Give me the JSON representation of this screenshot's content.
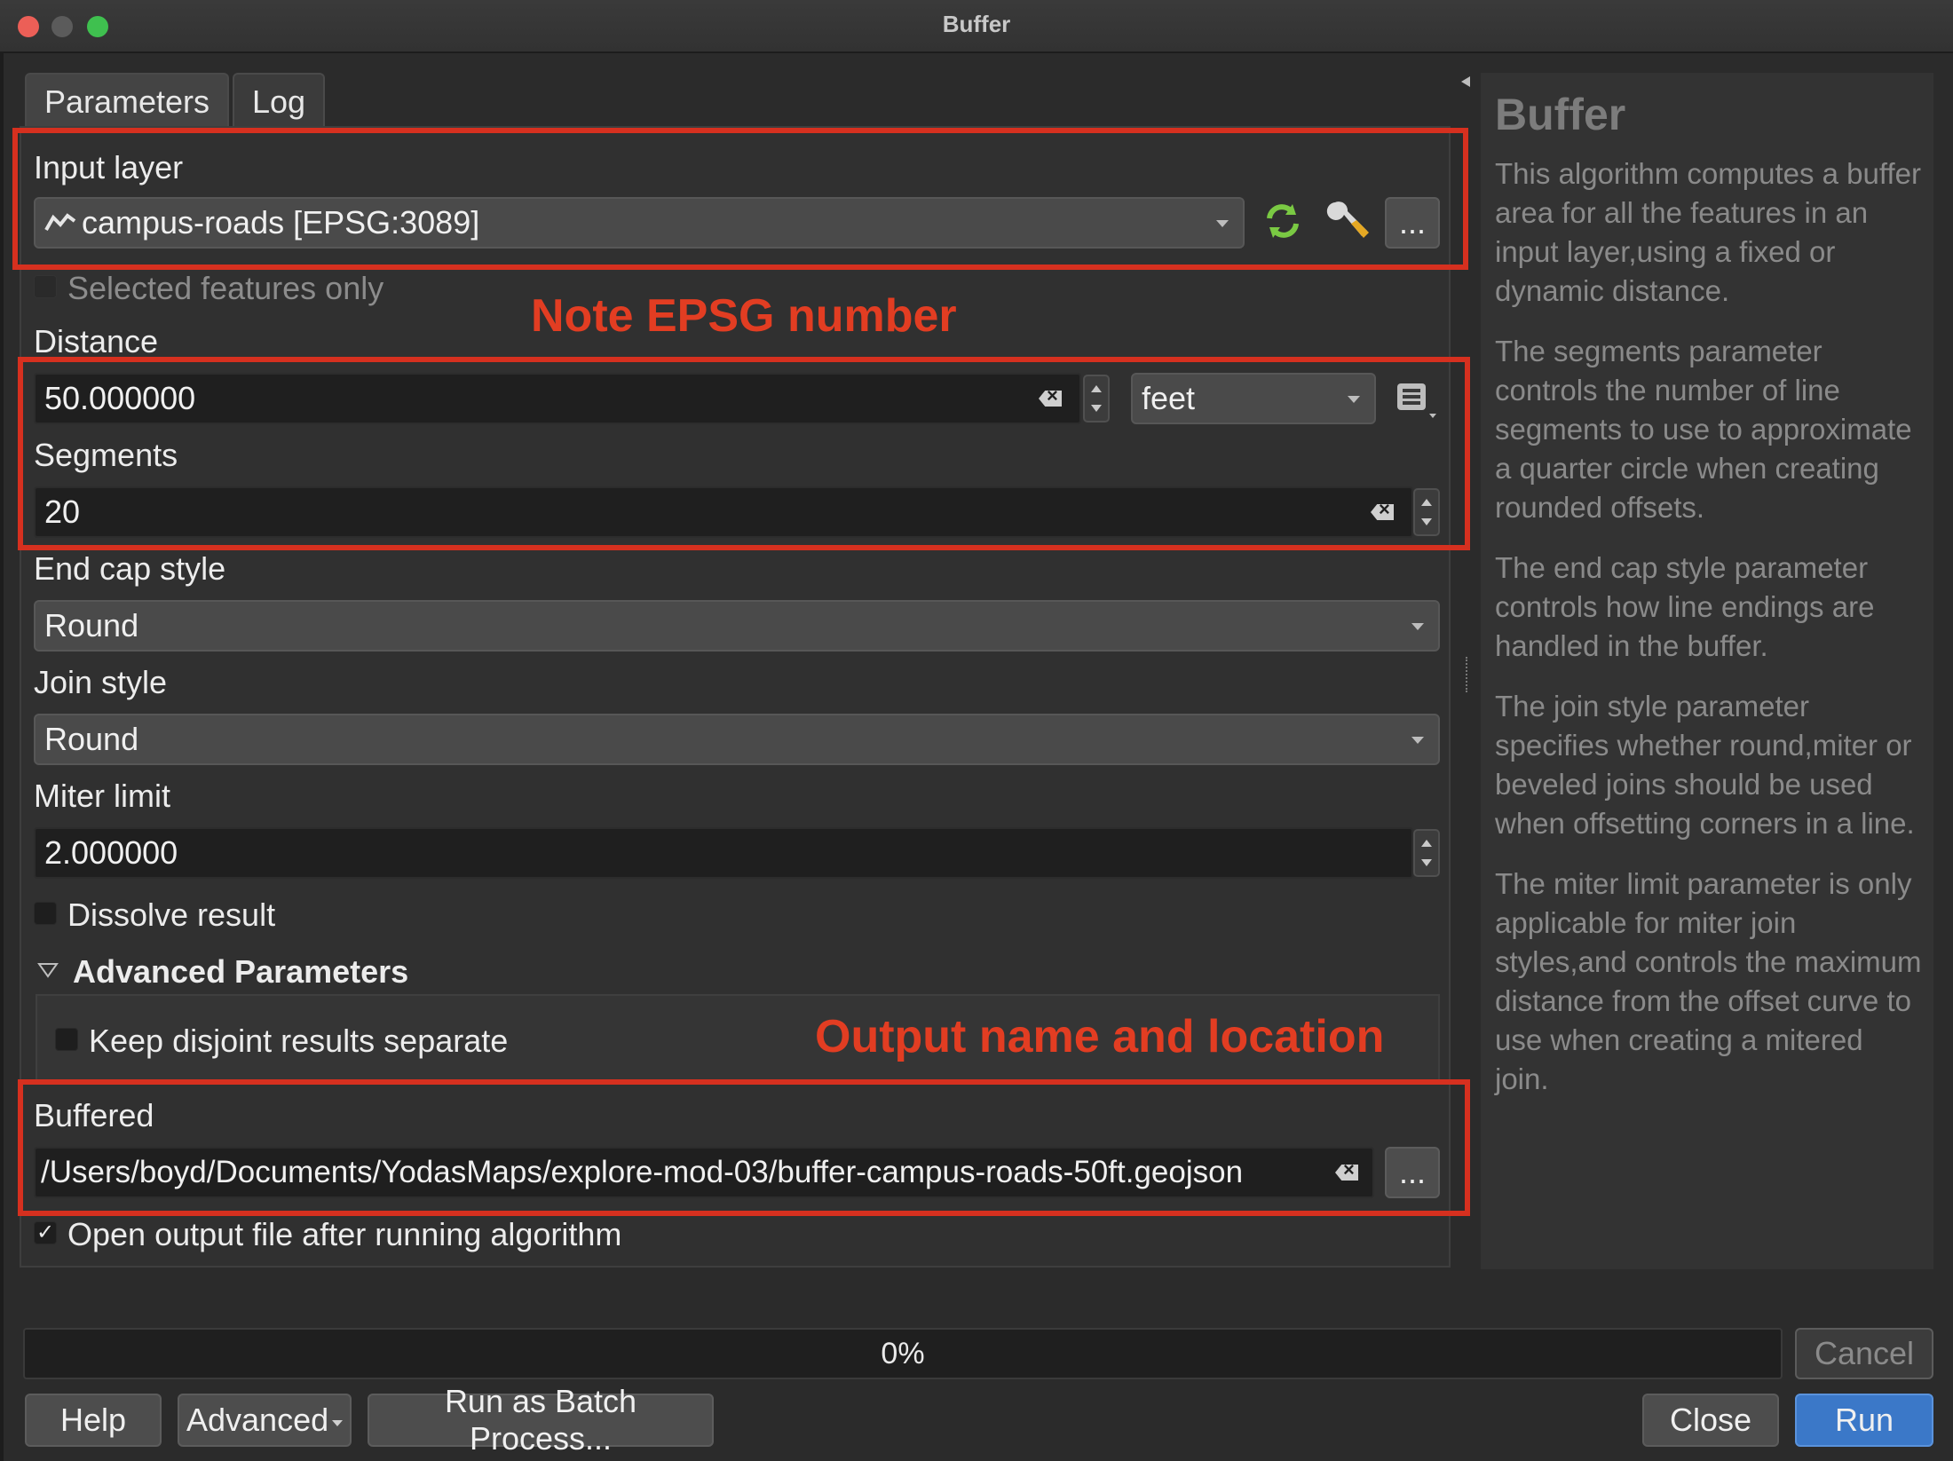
{
  "window": {
    "title": "Buffer"
  },
  "tabs": [
    {
      "label": "Parameters"
    },
    {
      "label": "Log"
    }
  ],
  "input_layer": {
    "label": "Input layer",
    "value": "campus-roads [EPSG:3089]",
    "selected_only_label": "Selected features only",
    "selected_only_checked": false
  },
  "distance": {
    "label": "Distance",
    "value": "50.000000",
    "unit": "feet"
  },
  "segments": {
    "label": "Segments",
    "value": "20"
  },
  "end_cap": {
    "label": "End cap style",
    "value": "Round"
  },
  "join_style": {
    "label": "Join style",
    "value": "Round"
  },
  "miter_limit": {
    "label": "Miter limit",
    "value": "2.000000"
  },
  "dissolve": {
    "label": "Dissolve result",
    "checked": false
  },
  "advanced": {
    "label": "Advanced Parameters",
    "keep_disjoint_label": "Keep disjoint results separate",
    "keep_disjoint_checked": false
  },
  "output": {
    "label": "Buffered",
    "value": "/Users/boyd/Documents/YodasMaps/explore-mod-03/buffer-campus-roads-50ft.geojson",
    "open_after_label": "Open output file after running algorithm",
    "open_after_checked": true,
    "check_mark": "✓"
  },
  "annotations": {
    "epsg_note": "Note EPSG number",
    "output_note": "Output name and location",
    "color": "#d6301f"
  },
  "help": {
    "title": "Buffer",
    "paragraphs": [
      "This algorithm computes a buffer area for all the features in an input layer,using a fixed or dynamic distance.",
      "The segments parameter controls the number of line segments to use to approximate a quarter circle when creating rounded offsets.",
      "The end cap style parameter controls how line endings are handled in the buffer.",
      "The join style parameter specifies whether round,miter or beveled joins should be used when offsetting corners in a line.",
      "The miter limit parameter is only applicable for miter join styles,and controls the maximum distance from the offset curve to use when creating a mitered join."
    ]
  },
  "progress": {
    "value": 0,
    "label": "0%"
  },
  "buttons": {
    "ellipsis": "...",
    "cancel": "Cancel",
    "help": "Help",
    "advanced": "Advanced",
    "batch": "Run as Batch Process...",
    "close": "Close",
    "run": "Run"
  },
  "icons": {
    "layer": "line-layer-icon",
    "iterate": "iterate-icon",
    "settings": "wrench-icon",
    "data_defined": "data-defined-icon",
    "clear": "clear-icon"
  }
}
